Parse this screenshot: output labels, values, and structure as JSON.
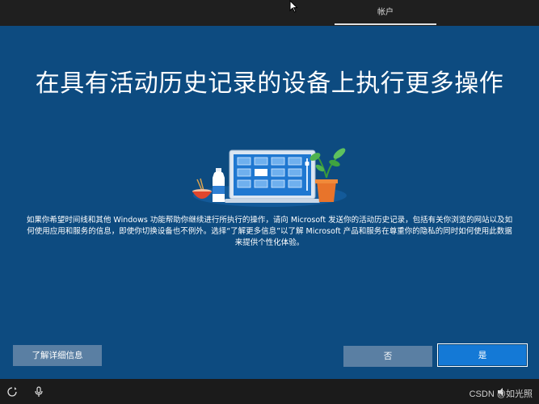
{
  "top_bar": {
    "account_tab_label": "帐户"
  },
  "main": {
    "title": "在具有活动历史记录的设备上执行更多操作",
    "description": "如果你希望时间线和其他 Windows 功能帮助你继续进行所执行的操作，请向 Microsoft 发送你的活动历史记录，包括有关你浏览的网站以及如何使用应用和服务的信息，即使你切换设备也不例外。选择“了解更多信息”以了解 Microsoft 产品和服务在尊重你的隐私的同时如何使用此数据来提供个性化体验。"
  },
  "buttons": {
    "learn_more": "了解详细信息",
    "no": "否",
    "yes": "是"
  },
  "bottom_bar": {
    "icons": [
      "ease-of-access-icon",
      "microphone-icon",
      "volume-icon"
    ],
    "watermark": "CSDN @如光照"
  },
  "colors": {
    "background": "#0d4b80",
    "primary_button": "#1479d6",
    "secondary_button": "#5a7fa3"
  }
}
